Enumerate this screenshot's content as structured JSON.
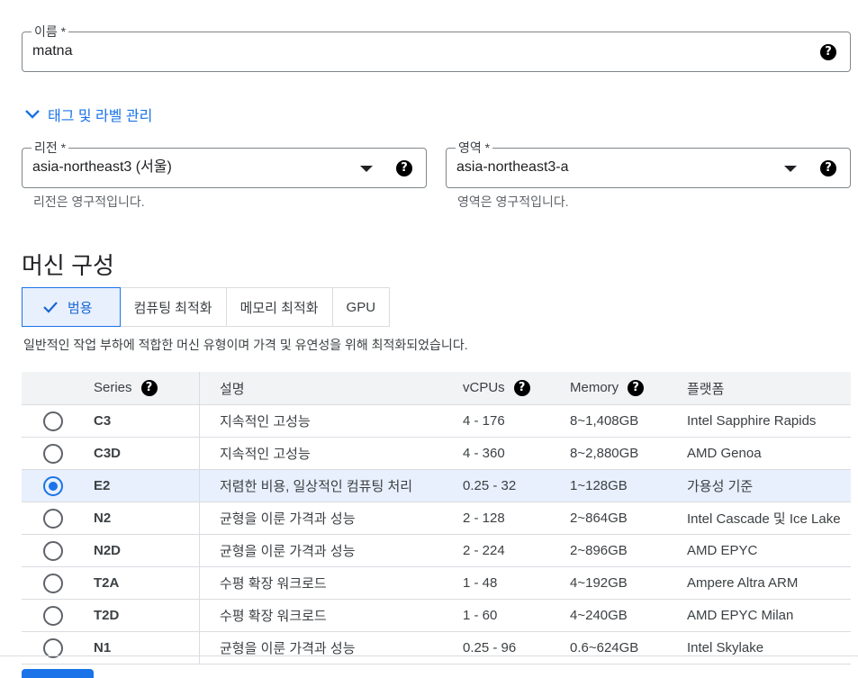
{
  "name_field": {
    "label": "이름 *",
    "value": "matna",
    "help": "?"
  },
  "tags_link": {
    "label": "태그 및 라벨 관리"
  },
  "region": {
    "label": "리전 *",
    "value": "asia-northeast3 (서울)",
    "hint": "리전은 영구적입니다.",
    "help": "?"
  },
  "zone": {
    "label": "영역 *",
    "value": "asia-northeast3-a",
    "hint": "영역은 영구적입니다.",
    "help": "?"
  },
  "machine": {
    "title": "머신 구성",
    "tabs": [
      {
        "label": "범용",
        "selected": true
      },
      {
        "label": "컴퓨팅 최적화"
      },
      {
        "label": "메모리 최적화"
      },
      {
        "label": "GPU"
      }
    ],
    "description": "일반적인 작업 부하에 적합한 머신 유형이며 가격 및 유연성을 위해 최적화되었습니다."
  },
  "table": {
    "headers": {
      "series": "Series",
      "desc": "설명",
      "vcpus": "vCPUs",
      "memory": "Memory",
      "platform": "플랫폼",
      "help": "?"
    },
    "rows": [
      {
        "series": "C3",
        "desc": "지속적인 고성능",
        "vcpus": "4 - 176",
        "memory": "8~1,408GB",
        "platform": "Intel Sapphire Rapids",
        "selected": false
      },
      {
        "series": "C3D",
        "desc": "지속적인 고성능",
        "vcpus": "4 - 360",
        "memory": "8~2,880GB",
        "platform": "AMD Genoa",
        "selected": false
      },
      {
        "series": "E2",
        "desc": "저렴한 비용, 일상적인 컴퓨팅 처리",
        "vcpus": "0.25 - 32",
        "memory": "1~128GB",
        "platform": "가용성 기준",
        "selected": true
      },
      {
        "series": "N2",
        "desc": "균형을 이룬 가격과 성능",
        "vcpus": "2 - 128",
        "memory": "2~864GB",
        "platform": "Intel Cascade 및 Ice Lake",
        "selected": false
      },
      {
        "series": "N2D",
        "desc": "균형을 이룬 가격과 성능",
        "vcpus": "2 - 224",
        "memory": "2~896GB",
        "platform": "AMD EPYC",
        "selected": false
      },
      {
        "series": "T2A",
        "desc": "수평 확장 워크로드",
        "vcpus": "1 - 48",
        "memory": "4~192GB",
        "platform": "Ampere Altra ARM",
        "selected": false
      },
      {
        "series": "T2D",
        "desc": "수평 확장 워크로드",
        "vcpus": "1 - 60",
        "memory": "4~240GB",
        "platform": "AMD EPYC Milan",
        "selected": false
      },
      {
        "series": "N1",
        "desc": "균형을 이룬 가격과 성능",
        "vcpus": "0.25 - 96",
        "memory": "0.6~624GB",
        "platform": "Intel Skylake",
        "selected": false
      }
    ]
  },
  "colors": {
    "accent": "#1a73e8",
    "selected_bg": "#e8f0fe",
    "header_bg": "#f1f3f4"
  }
}
